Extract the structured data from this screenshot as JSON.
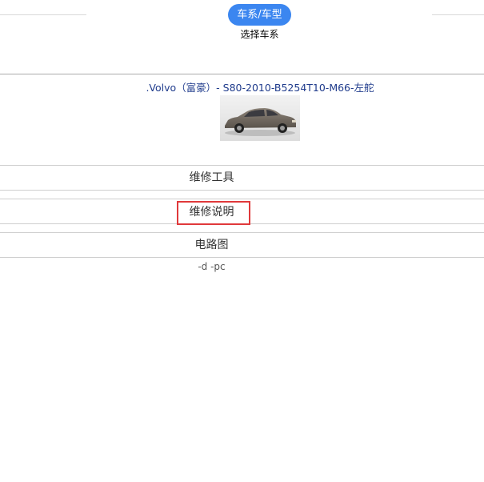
{
  "stepper": {
    "pill_label": "车系/车型",
    "step_label": "选择车系"
  },
  "vehicle": {
    "title": ".Volvo（富豪）- S80-2010-B5254T10-M66-左舵",
    "image_name": "car-photo"
  },
  "menu": {
    "tools": "维修工具",
    "manual": "维修说明",
    "wiring": "电路图"
  },
  "footer": {
    "code": "-d -pc"
  },
  "colors": {
    "accent": "#3b86f0",
    "highlight": "#e0393b",
    "title": "#1f3b8c"
  }
}
